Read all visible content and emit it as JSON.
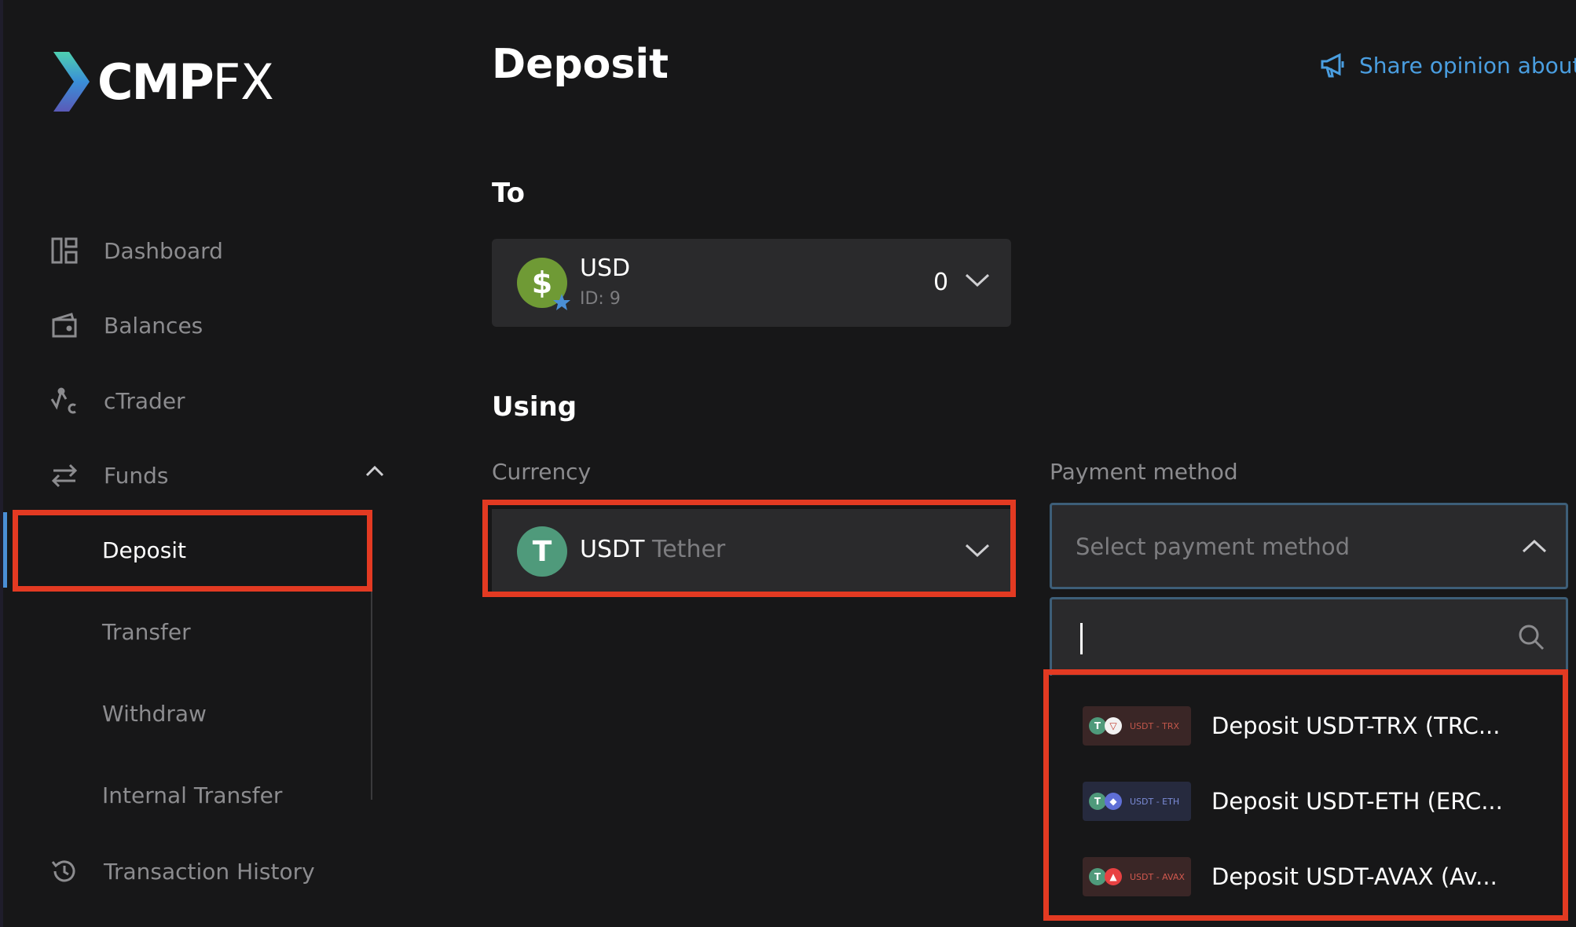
{
  "brand": {
    "name_bold": "CMP",
    "name_light": "FX"
  },
  "sidebar": {
    "items": [
      {
        "label": "Dashboard",
        "icon": "dashboard-icon"
      },
      {
        "label": "Balances",
        "icon": "wallet-icon"
      },
      {
        "label": "cTrader",
        "icon": "ctrader-icon"
      },
      {
        "label": "Funds",
        "icon": "transfer-arrows-icon",
        "expanded": true
      },
      {
        "label": "Transaction History",
        "icon": "history-icon"
      }
    ],
    "funds_sub": [
      "Deposit",
      "Transfer",
      "Withdraw",
      "Internal Transfer"
    ],
    "active_sub": "Deposit"
  },
  "header": {
    "title": "Deposit",
    "share_label": "Share opinion about"
  },
  "to_section": {
    "title": "To",
    "account": {
      "name": "USD",
      "id_label": "ID: 9",
      "balance": "0",
      "symbol": "$"
    }
  },
  "using_section": {
    "title": "Using",
    "currency_label": "Currency",
    "currency": {
      "code": "USDT",
      "name": "Tether",
      "symbol": "T"
    },
    "payment_label": "Payment method",
    "payment_placeholder": "Select payment method",
    "search_value": "",
    "options": [
      {
        "badge": "USDT - TRX",
        "label": "Deposit USDT-TRX (TRC...",
        "badge_bg": "#3a2626",
        "badge_color": "#c0564a",
        "coin2_bg": "#f2f2f2",
        "coin2_color": "#c0392b",
        "coin2": "▽"
      },
      {
        "badge": "USDT - ETH",
        "label": "Deposit USDT-ETH (ERC...",
        "badge_bg": "#262a3e",
        "badge_color": "#7b8bd6",
        "coin2_bg": "#5f6fd6",
        "coin2_color": "#ffffff",
        "coin2": "◆"
      },
      {
        "badge": "USDT - AVAX",
        "label": "Deposit USDT-AVAX (Av...",
        "badge_bg": "#3a2626",
        "badge_color": "#d0584e",
        "coin2_bg": "#e84142",
        "coin2_color": "#ffffff",
        "coin2": "▲"
      }
    ]
  },
  "colors": {
    "accent": "#4a8fd6",
    "highlight": "#e33a22",
    "usd_icon": "#6f9a35",
    "usdt_icon": "#4f9a7b"
  }
}
